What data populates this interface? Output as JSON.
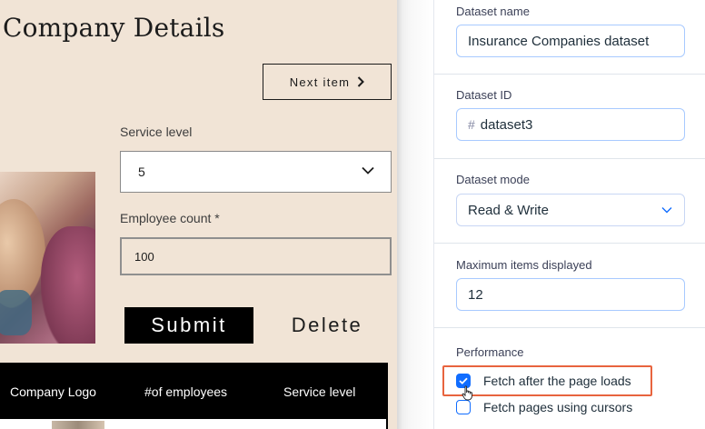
{
  "canvas": {
    "title": "Company Details",
    "next_button": {
      "label": "Next item",
      "icon": "chevron-right-icon"
    },
    "service_level": {
      "label": "Service level",
      "value": "5"
    },
    "employee_count": {
      "label": "Employee count *",
      "value": "100"
    },
    "submit_label": "Submit",
    "delete_label": "Delete",
    "table": {
      "columns": [
        "Company Logo",
        "#of employees",
        "Service level"
      ]
    },
    "colors": {
      "background": "#f1e4d6",
      "button": "#000000"
    }
  },
  "panel": {
    "dataset_name": {
      "label": "Dataset name",
      "value": "Insurance Companies dataset"
    },
    "dataset_id": {
      "label": "Dataset ID",
      "prefix": "#",
      "value": "dataset3"
    },
    "dataset_mode": {
      "label": "Dataset mode",
      "value": "Read & Write"
    },
    "max_items": {
      "label": "Maximum items displayed",
      "value": "12"
    },
    "performance": {
      "label": "Performance",
      "options": [
        {
          "label": "Fetch after the page loads",
          "checked": true
        },
        {
          "label": "Fetch pages using cursors",
          "checked": false
        }
      ]
    },
    "colors": {
      "accent": "#116dff",
      "highlight": "#e8643e",
      "input_border": "#a8caff"
    }
  }
}
